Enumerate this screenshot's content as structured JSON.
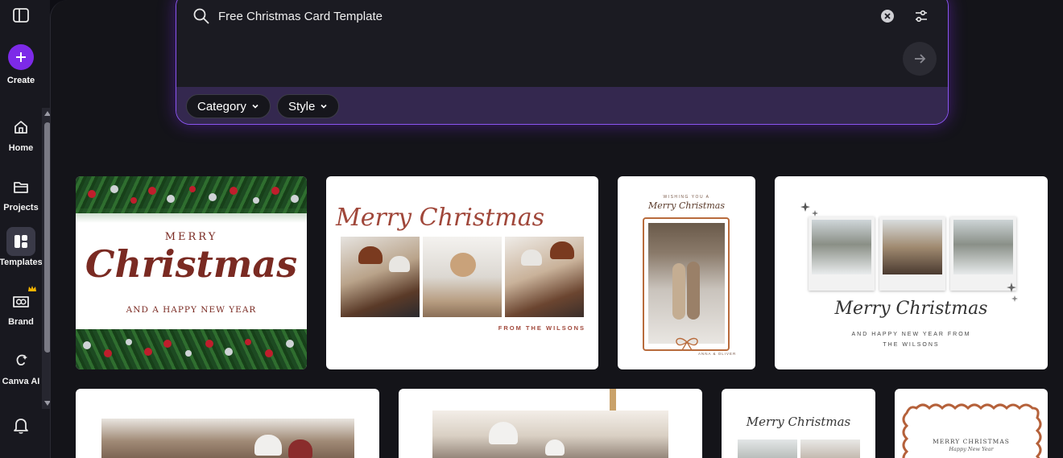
{
  "sidebar": {
    "create_label": "Create",
    "items": [
      {
        "label": "Home",
        "icon": "home-icon"
      },
      {
        "label": "Projects",
        "icon": "folder-icon"
      },
      {
        "label": "Templates",
        "icon": "templates-icon"
      },
      {
        "label": "Brand",
        "icon": "brand-icon"
      },
      {
        "label": "Canva AI",
        "icon": "canva-ai-icon"
      }
    ]
  },
  "search": {
    "query": "Free Christmas Card Template",
    "filters": [
      {
        "label": "Category"
      },
      {
        "label": "Style"
      }
    ]
  },
  "templates": [
    {
      "line1": "MERRY",
      "line2": "Christmas",
      "line3": "AND A HAPPY NEW YEAR"
    },
    {
      "title": "Merry Christmas",
      "footer": "FROM THE WILSONS"
    },
    {
      "top": "WISHING YOU A",
      "title": "Merry Christmas",
      "names": "ANNA & OLIVER"
    },
    {
      "title": "Merry Christmas",
      "line1": "AND HAPPY NEW YEAR FROM",
      "line2": "THE WILSONS"
    },
    {},
    {},
    {
      "title": "Merry Christmas"
    },
    {
      "line1": "MERRY CHRISTMAS",
      "line2": "Happy New Year"
    }
  ],
  "colors": {
    "accent": "#7d2ae8",
    "christmas_red": "#8b2e23",
    "copper": "#b86b3c"
  }
}
